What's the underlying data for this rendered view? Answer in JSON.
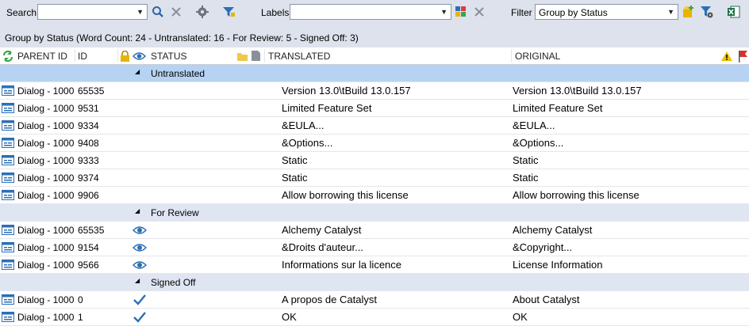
{
  "toolbar": {
    "search_label": "Search",
    "search_value": "",
    "labels_label": "Labels",
    "labels_value": "",
    "filter_label": "Filter",
    "filter_value": "Group by Status"
  },
  "group_info": "Group by Status (Word Count: 24 - Untranslated: 16 - For Review: 5 - Signed Off: 3)",
  "columns": {
    "parent_id": "PARENT ID",
    "id": "ID",
    "status": "STATUS",
    "translated": "TRANSLATED",
    "original": "ORIGINAL"
  },
  "groups": [
    {
      "label": "Untranslated",
      "rows": [
        {
          "parent": "Dialog - 1000",
          "id": "65535",
          "status": "",
          "translated": "Version 13.0\\tBuild 13.0.157",
          "original": "Version 13.0\\tBuild 13.0.157"
        },
        {
          "parent": "Dialog - 1000",
          "id": "9531",
          "status": "",
          "translated": "Limited Feature Set",
          "original": "Limited Feature Set"
        },
        {
          "parent": "Dialog - 1000",
          "id": "9334",
          "status": "",
          "translated": "&EULA...",
          "original": "&EULA..."
        },
        {
          "parent": "Dialog - 1000",
          "id": "9408",
          "status": "",
          "translated": "&Options...",
          "original": "&Options..."
        },
        {
          "parent": "Dialog - 1000",
          "id": "9333",
          "status": "",
          "translated": "Static",
          "original": "Static"
        },
        {
          "parent": "Dialog - 1000",
          "id": "9374",
          "status": "",
          "translated": "Static",
          "original": "Static"
        },
        {
          "parent": "Dialog - 1000",
          "id": "9906",
          "status": "",
          "translated": "Allow borrowing this license",
          "original": "Allow borrowing this license"
        }
      ]
    },
    {
      "label": "For Review",
      "rows": [
        {
          "parent": "Dialog - 1000",
          "id": "65535",
          "status": "review",
          "translated": "Alchemy Catalyst",
          "original": "Alchemy Catalyst"
        },
        {
          "parent": "Dialog - 1000",
          "id": "9154",
          "status": "review",
          "translated": "&Droits d'auteur...",
          "original": "&Copyright..."
        },
        {
          "parent": "Dialog - 1000",
          "id": "9566",
          "status": "review",
          "translated": "Informations sur la licence",
          "original": "License Information"
        }
      ]
    },
    {
      "label": "Signed Off",
      "rows": [
        {
          "parent": "Dialog - 1000",
          "id": "0",
          "status": "signed",
          "translated": "A propos de Catalyst",
          "original": "About Catalyst"
        },
        {
          "parent": "Dialog - 1000",
          "id": "1",
          "status": "signed",
          "translated": "OK",
          "original": "OK"
        }
      ]
    }
  ],
  "icons": {
    "row": "dialog-item-icon",
    "review": "eye-icon",
    "signed": "checkmark-icon"
  }
}
